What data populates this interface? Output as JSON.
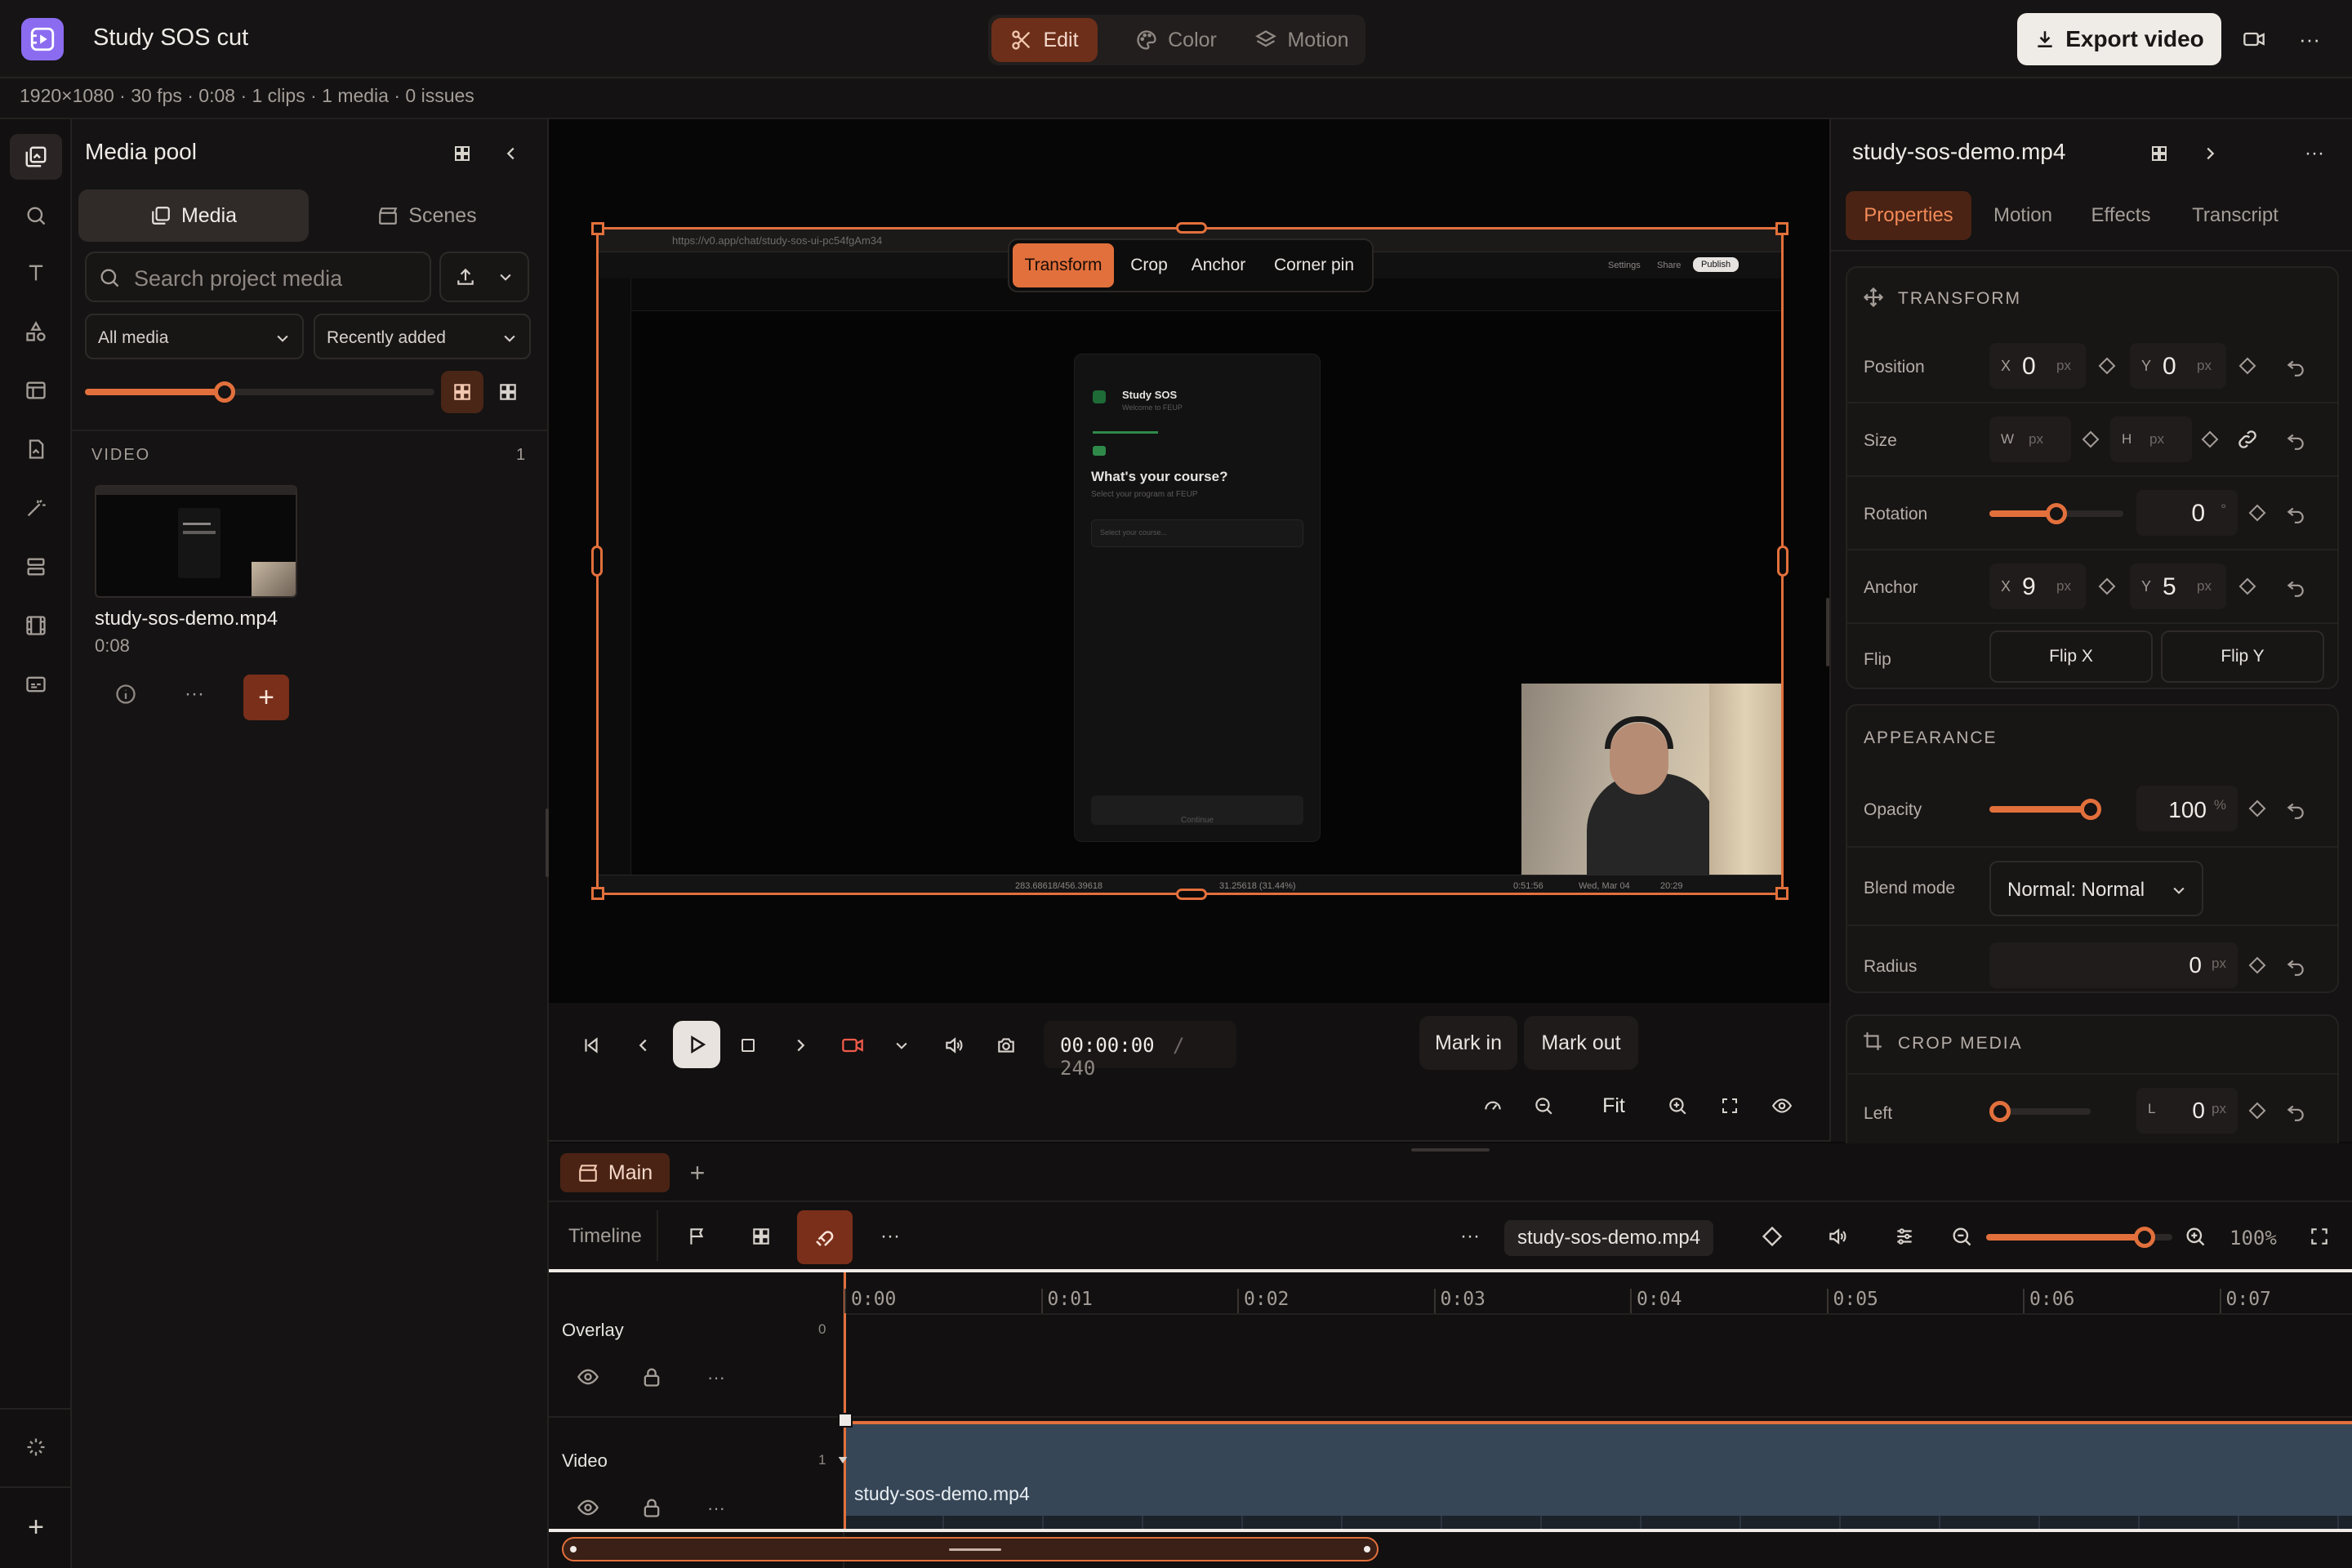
{
  "app": {
    "title": "Study SOS cut"
  },
  "modes": {
    "edit": "Edit",
    "color": "Color",
    "motion": "Motion"
  },
  "header": {
    "export_label": "Export video"
  },
  "status": {
    "text": "1920×1080 · 30 fps · 0:08 · 1 clips · 1 media · 0 issues"
  },
  "media_pool": {
    "title": "Media pool",
    "tabs": {
      "media": "Media",
      "scenes": "Scenes"
    },
    "search_placeholder": "Search project media",
    "filter": "All media",
    "sort": "Recently added",
    "thumb_size": 0.4,
    "section": {
      "label": "VIDEO",
      "count": "1"
    },
    "item": {
      "name": "study-sos-demo.mp4",
      "duration": "0:08"
    }
  },
  "preview": {
    "tabs": {
      "transform": "Transform",
      "crop": "Crop",
      "anchor": "Anchor",
      "corner_pin": "Corner pin"
    },
    "screen": {
      "url": "https://v0.app/chat/study-sos-ui-pc54fgAm34",
      "settings": "Settings",
      "share": "Share",
      "publish": "Publish",
      "card_title": "Study SOS",
      "card_subtitle": "Welcome to FEUP",
      "question": "What's your course?",
      "question_hint": "Select your program at FEUP",
      "select_placeholder": "Select your course...",
      "continue": "Continue",
      "taskbar_left": "283.68618/456.39618",
      "taskbar_mid": "31.25618 (31.44%)",
      "taskbar_time": "0:51:56",
      "taskbar_date": "Wed, Mar 04",
      "taskbar_clock": "20:29"
    }
  },
  "transport": {
    "timecode": "00:00:00",
    "separator": "/",
    "total_frames": "240",
    "mark_in": "Mark in",
    "mark_out": "Mark out",
    "fit": "Fit"
  },
  "inspector": {
    "filename": "study-sos-demo.mp4",
    "tabs": {
      "properties": "Properties",
      "motion": "Motion",
      "effects": "Effects",
      "transcript": "Transcript"
    },
    "transform": {
      "title": "TRANSFORM",
      "position": {
        "label": "Position",
        "x": "0",
        "y": "0",
        "unit": "px"
      },
      "size": {
        "label": "Size",
        "w": "W",
        "h": "H",
        "unit": "px"
      },
      "rotation": {
        "label": "Rotation",
        "value": "0",
        "unit": "°",
        "level": 0.5
      },
      "anchor": {
        "label": "Anchor",
        "x": "9",
        "y": "5",
        "unit": "px"
      },
      "flip": {
        "label": "Flip",
        "x": "Flip X",
        "y": "Flip Y"
      }
    },
    "appearance": {
      "title": "APPEARANCE",
      "opacity": {
        "label": "Opacity",
        "value": "100",
        "unit": "%",
        "level": 1.0
      },
      "blend": {
        "label": "Blend mode",
        "value": "Normal: Normal"
      },
      "radius": {
        "label": "Radius",
        "value": "0",
        "unit": "px"
      }
    },
    "crop": {
      "title": "CROP MEDIA",
      "left": {
        "label": "Left",
        "prefix": "L",
        "value": "0",
        "unit": "px",
        "level": 0
      }
    }
  },
  "timeline": {
    "sequence_tab": "Main",
    "label": "Timeline",
    "selected_clip": "study-sos-demo.mp4",
    "zoom": "100%",
    "zoom_level": 0.85,
    "ruler": [
      "0:00",
      "0:01",
      "0:02",
      "0:03",
      "0:04",
      "0:05",
      "0:06",
      "0:07"
    ],
    "tracks": {
      "overlay": {
        "name": "Overlay",
        "index": "0"
      },
      "video": {
        "name": "Video",
        "index": "1"
      }
    },
    "clip": {
      "name": "study-sos-demo.mp4"
    }
  },
  "colors": {
    "accent": "#e2703c",
    "clip": "#364656",
    "bg": "#0d0c0c"
  }
}
